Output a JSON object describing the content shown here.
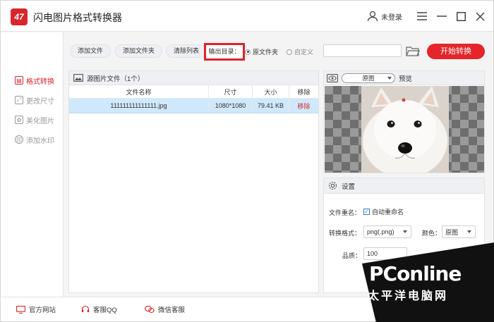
{
  "app": {
    "title": "闪电图片格式转换器",
    "logo_text": "47"
  },
  "user": {
    "label": "未登录"
  },
  "sidebar": {
    "items": [
      {
        "label": "格式转换",
        "active": true
      },
      {
        "label": "更改尺寸",
        "active": false
      },
      {
        "label": "美化图片",
        "active": false
      },
      {
        "label": "添加水印",
        "active": false
      }
    ]
  },
  "toolbar": {
    "add_file": "添加文件",
    "add_folder": "添加文件夹",
    "clear_list": "清除列表",
    "output_dir": "输出目录：",
    "radio_original": "原文件夹",
    "radio_custom": "自定义",
    "path_value": "",
    "start": "开始转换"
  },
  "file_panel": {
    "title": "源图片文件（1个）",
    "columns": [
      "文件名称",
      "尺寸",
      "大小",
      "移除"
    ],
    "rows": [
      {
        "name": "111111111111111.jpg",
        "size": "1080*1080",
        "filesize": "79.41 KB",
        "remove": "移除"
      }
    ]
  },
  "preview": {
    "mode": "原图",
    "label": "预览"
  },
  "settings": {
    "title": "设置",
    "rename_label": "文件重名：",
    "auto_rename": "自动重命名",
    "format_label": "转换格式：",
    "format_value": "png(.png)",
    "color_label": "颜色：",
    "color_value": "原图",
    "quality_label": "品质：",
    "quality_value": "100"
  },
  "footer": {
    "website": "官方网站",
    "qq": "客服QQ",
    "wechat": "微信客服"
  },
  "watermark": {
    "brand": "PConline",
    "sub": "太平洋电脑网"
  },
  "colors": {
    "accent": "#e5252a",
    "highlight_row": "#cfe8fb"
  }
}
